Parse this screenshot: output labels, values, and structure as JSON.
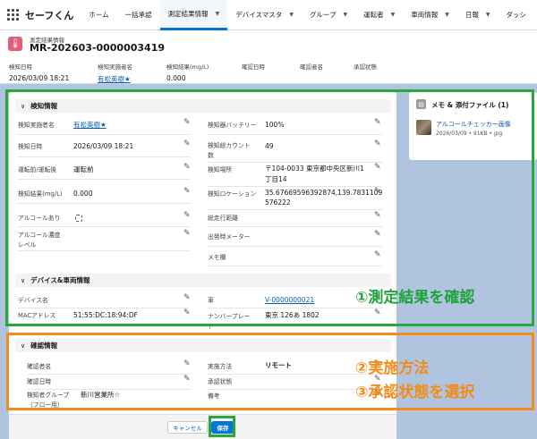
{
  "app": {
    "name": "セーフくん"
  },
  "nav": {
    "tabs": [
      {
        "label": "ホーム",
        "dropdown": false,
        "active": false
      },
      {
        "label": "一括承認",
        "dropdown": false,
        "active": false
      },
      {
        "label": "測定結果情報",
        "dropdown": true,
        "active": true
      },
      {
        "label": "デバイスマスタ",
        "dropdown": true,
        "active": false
      },
      {
        "label": "グループ",
        "dropdown": true,
        "active": false
      },
      {
        "label": "運転者",
        "dropdown": true,
        "active": false
      },
      {
        "label": "車両情報",
        "dropdown": true,
        "active": false
      },
      {
        "label": "日報",
        "dropdown": true,
        "active": false
      },
      {
        "label": "ダッシ",
        "dropdown": false,
        "active": false
      }
    ]
  },
  "header": {
    "object_label": "測定結果情報",
    "record_name": "MR-202603-0000003419",
    "fields": [
      {
        "label": "検知日時",
        "value": "2026/03/09 18:21"
      },
      {
        "label": "検知実施者名",
        "value": "有松英樹★"
      },
      {
        "label": "検知結果(mg/L)",
        "value": "0.000"
      },
      {
        "label": "確認日時",
        "value": ""
      },
      {
        "label": "確認者名",
        "value": ""
      },
      {
        "label": "承認状態",
        "value": ""
      }
    ]
  },
  "sections": {
    "detection": {
      "title": "検知情報",
      "driver_name_label": "検知実施者名",
      "driver_name": "有松英樹★",
      "battery_label": "検知器バッテリー",
      "battery": "100%",
      "detected_at_label": "検知日時",
      "detected_at": "2026/03/09 18:21",
      "total_count_label_1": "検知総カウント",
      "total_count_label_2": "数",
      "total_count": "49",
      "phase_label": "運転前/運転後",
      "phase": "運転前",
      "place_label": "検知場所",
      "place_1": "〒104-0033 東京都中央区新川1",
      "place_2": "丁目14",
      "result_label": "検知結果(mg/L)",
      "result": "0.000",
      "location_label": "検知ロケーション",
      "location_1": "35.67669596392874,139.7831109",
      "location_2": "576222",
      "alcohol_label": "アルコールあり",
      "distance_label": "総走行距離",
      "concentration_label_1": "アルコール濃度",
      "concentration_label_2": "レベル",
      "meter_label": "出発時メーター",
      "memo_label": "メモ欄"
    },
    "device": {
      "title": "デバイス&車両情報",
      "device_name_label": "デバイス名",
      "device_name": "",
      "vehicle_label": "車",
      "vehicle": "V-0000000021",
      "mac_label": "MACアドレス",
      "mac": "51:55:DC:18:94:DF",
      "plate_label_1": "ナンバープレー",
      "plate_label_2": "ト",
      "plate": "東京 126あ 1802"
    },
    "confirmation": {
      "title": "確認情報",
      "confirmer_label": "確認者名",
      "confirmer": "",
      "method_label": "実施方法",
      "method": "リモート",
      "confirmed_at_label": "確認日時",
      "confirmed_at": "",
      "approval_label": "承認状態",
      "approval": "",
      "group_label_1": "検知者グループ",
      "group_label_2": "（フロー用）",
      "group": "新川営業所☆",
      "remarks_label": "備考",
      "remarks": ""
    }
  },
  "footer": {
    "cancel_label": "キャンセル",
    "save_label": "保存"
  },
  "panel": {
    "title": "メモ & 添付ファイル (1)",
    "file_name": "アルコールチェッカー画像",
    "file_meta": "2026/03/09 • 91KB • jpg"
  },
  "annotations": {
    "step1": "①測定結果を確認",
    "step2": "②実施方法",
    "step3": "③承認状態を選択"
  },
  "colors": {
    "accent": "#0176d3",
    "annotation_green": "#27a83a",
    "annotation_orange": "#f28c1a",
    "record_icon": "#e35d7b"
  }
}
